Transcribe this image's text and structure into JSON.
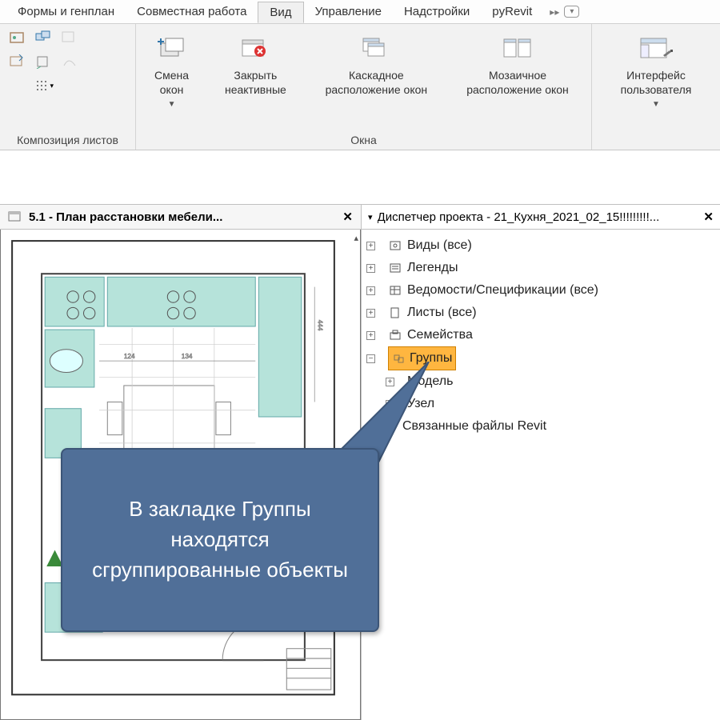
{
  "tabs": {
    "forms": "Формы и генплан",
    "collab": "Совместная работа",
    "view": "Вид",
    "manage": "Управление",
    "addins": "Надстройки",
    "pyrevit": "pyRevit"
  },
  "ribbon": {
    "panel_sheets": "Композиция листов",
    "panel_windows": "Окна",
    "switch_windows": "Смена окон",
    "close_inactive": "Закрыть неактивные",
    "cascade": "Каскадное расположение окон",
    "tile": "Мозаичное расположение окон",
    "ui": "Интерфейс пользователя"
  },
  "doc": {
    "title": "5.1 - План расстановки мебели..."
  },
  "browser": {
    "title": "Диспетчер проекта - 21_Кухня_2021_02_15!!!!!!!!!...",
    "views": "Виды (все)",
    "legends": "Легенды",
    "schedules": "Ведомости/Спецификации (все)",
    "sheets": "Листы (все)",
    "families": "Семейства",
    "groups": "Группы",
    "model": "Модель",
    "detail": "Узел",
    "links": "Связанные файлы Revit"
  },
  "callout": {
    "text": "В закладке Группы находятся сгруппированные объекты"
  }
}
